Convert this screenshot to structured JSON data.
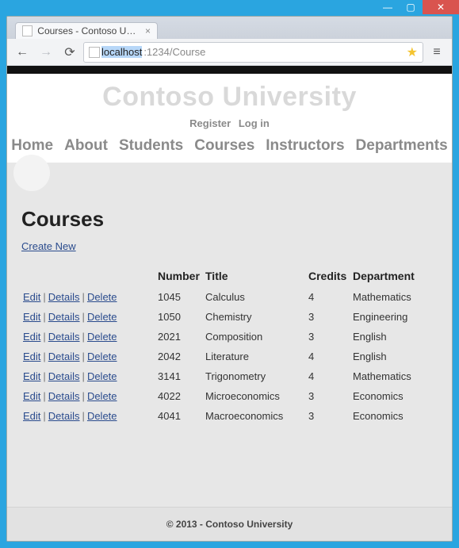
{
  "window": {
    "tab_title": "Courses - Contoso Univer",
    "address_host": "localhost",
    "address_rest": ":1234/Course"
  },
  "site": {
    "title": "Contoso University",
    "auth": {
      "register": "Register",
      "login": "Log in"
    },
    "nav": [
      "Home",
      "About",
      "Students",
      "Courses",
      "Instructors",
      "Departments"
    ]
  },
  "page": {
    "heading": "Courses",
    "create_label": "Create New",
    "columns": {
      "number": "Number",
      "title": "Title",
      "credits": "Credits",
      "department": "Department"
    },
    "action_labels": {
      "edit": "Edit",
      "details": "Details",
      "delete": "Delete"
    },
    "rows": [
      {
        "number": "1045",
        "title": "Calculus",
        "credits": "4",
        "department": "Mathematics"
      },
      {
        "number": "1050",
        "title": "Chemistry",
        "credits": "3",
        "department": "Engineering"
      },
      {
        "number": "2021",
        "title": "Composition",
        "credits": "3",
        "department": "English"
      },
      {
        "number": "2042",
        "title": "Literature",
        "credits": "4",
        "department": "English"
      },
      {
        "number": "3141",
        "title": "Trigonometry",
        "credits": "4",
        "department": "Mathematics"
      },
      {
        "number": "4022",
        "title": "Microeconomics",
        "credits": "3",
        "department": "Economics"
      },
      {
        "number": "4041",
        "title": "Macroeconomics",
        "credits": "3",
        "department": "Economics"
      }
    ]
  },
  "footer": {
    "text": "© 2013 - Contoso University"
  }
}
